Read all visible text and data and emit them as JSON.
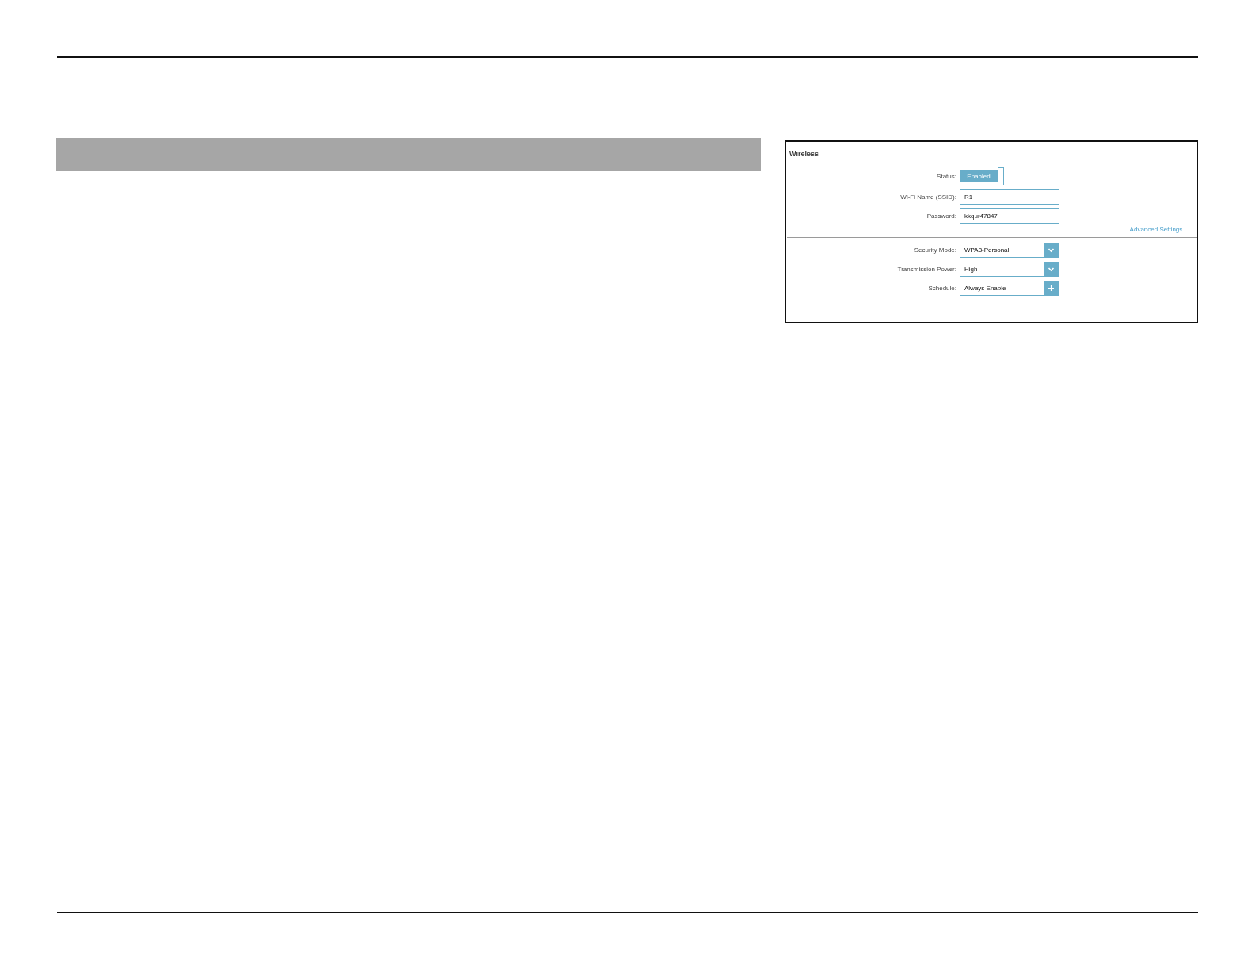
{
  "panel": {
    "title": "Wireless",
    "fields": [
      {
        "kind": "toggle",
        "label": "Status:",
        "value": "Enabled",
        "on": true
      },
      {
        "kind": "text",
        "label": "Wi-Fi Name (SSID):",
        "value": "R1"
      },
      {
        "kind": "text",
        "label": "Password:",
        "value": "kkqur47847"
      }
    ],
    "link": "Advanced Settings...",
    "settings": [
      {
        "kind": "select",
        "label": "Security Mode:",
        "value": "WPA3-Personal"
      },
      {
        "kind": "select",
        "label": "Transmission Power:",
        "value": "High"
      },
      {
        "kind": "add",
        "label": "Schedule:",
        "value": "Always Enable"
      }
    ]
  }
}
